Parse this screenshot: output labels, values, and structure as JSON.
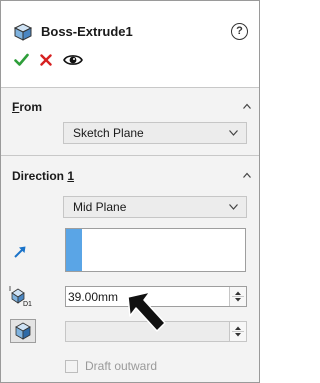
{
  "header": {
    "title": "Boss-Extrude1",
    "icons": [
      "extrude-icon",
      "help-icon",
      "ok-checkmark-icon",
      "cancel-x-icon",
      "preview-eye-icon"
    ]
  },
  "from_section": {
    "title_prefix": "F",
    "title_rest": "rom",
    "start_condition": "Sketch Plane"
  },
  "direction_section": {
    "title_prefix": "Direction ",
    "title_num": "1",
    "end_condition": "Mid Plane",
    "depth_value": "39.00mm",
    "draft_label": "Draft outward",
    "draft_checked": false
  },
  "colors": {
    "accent_blue": "#5aa5e6",
    "ok_green": "#2e9e3a",
    "cancel_red": "#d62020",
    "arrow_blue": "#1a73c9"
  }
}
